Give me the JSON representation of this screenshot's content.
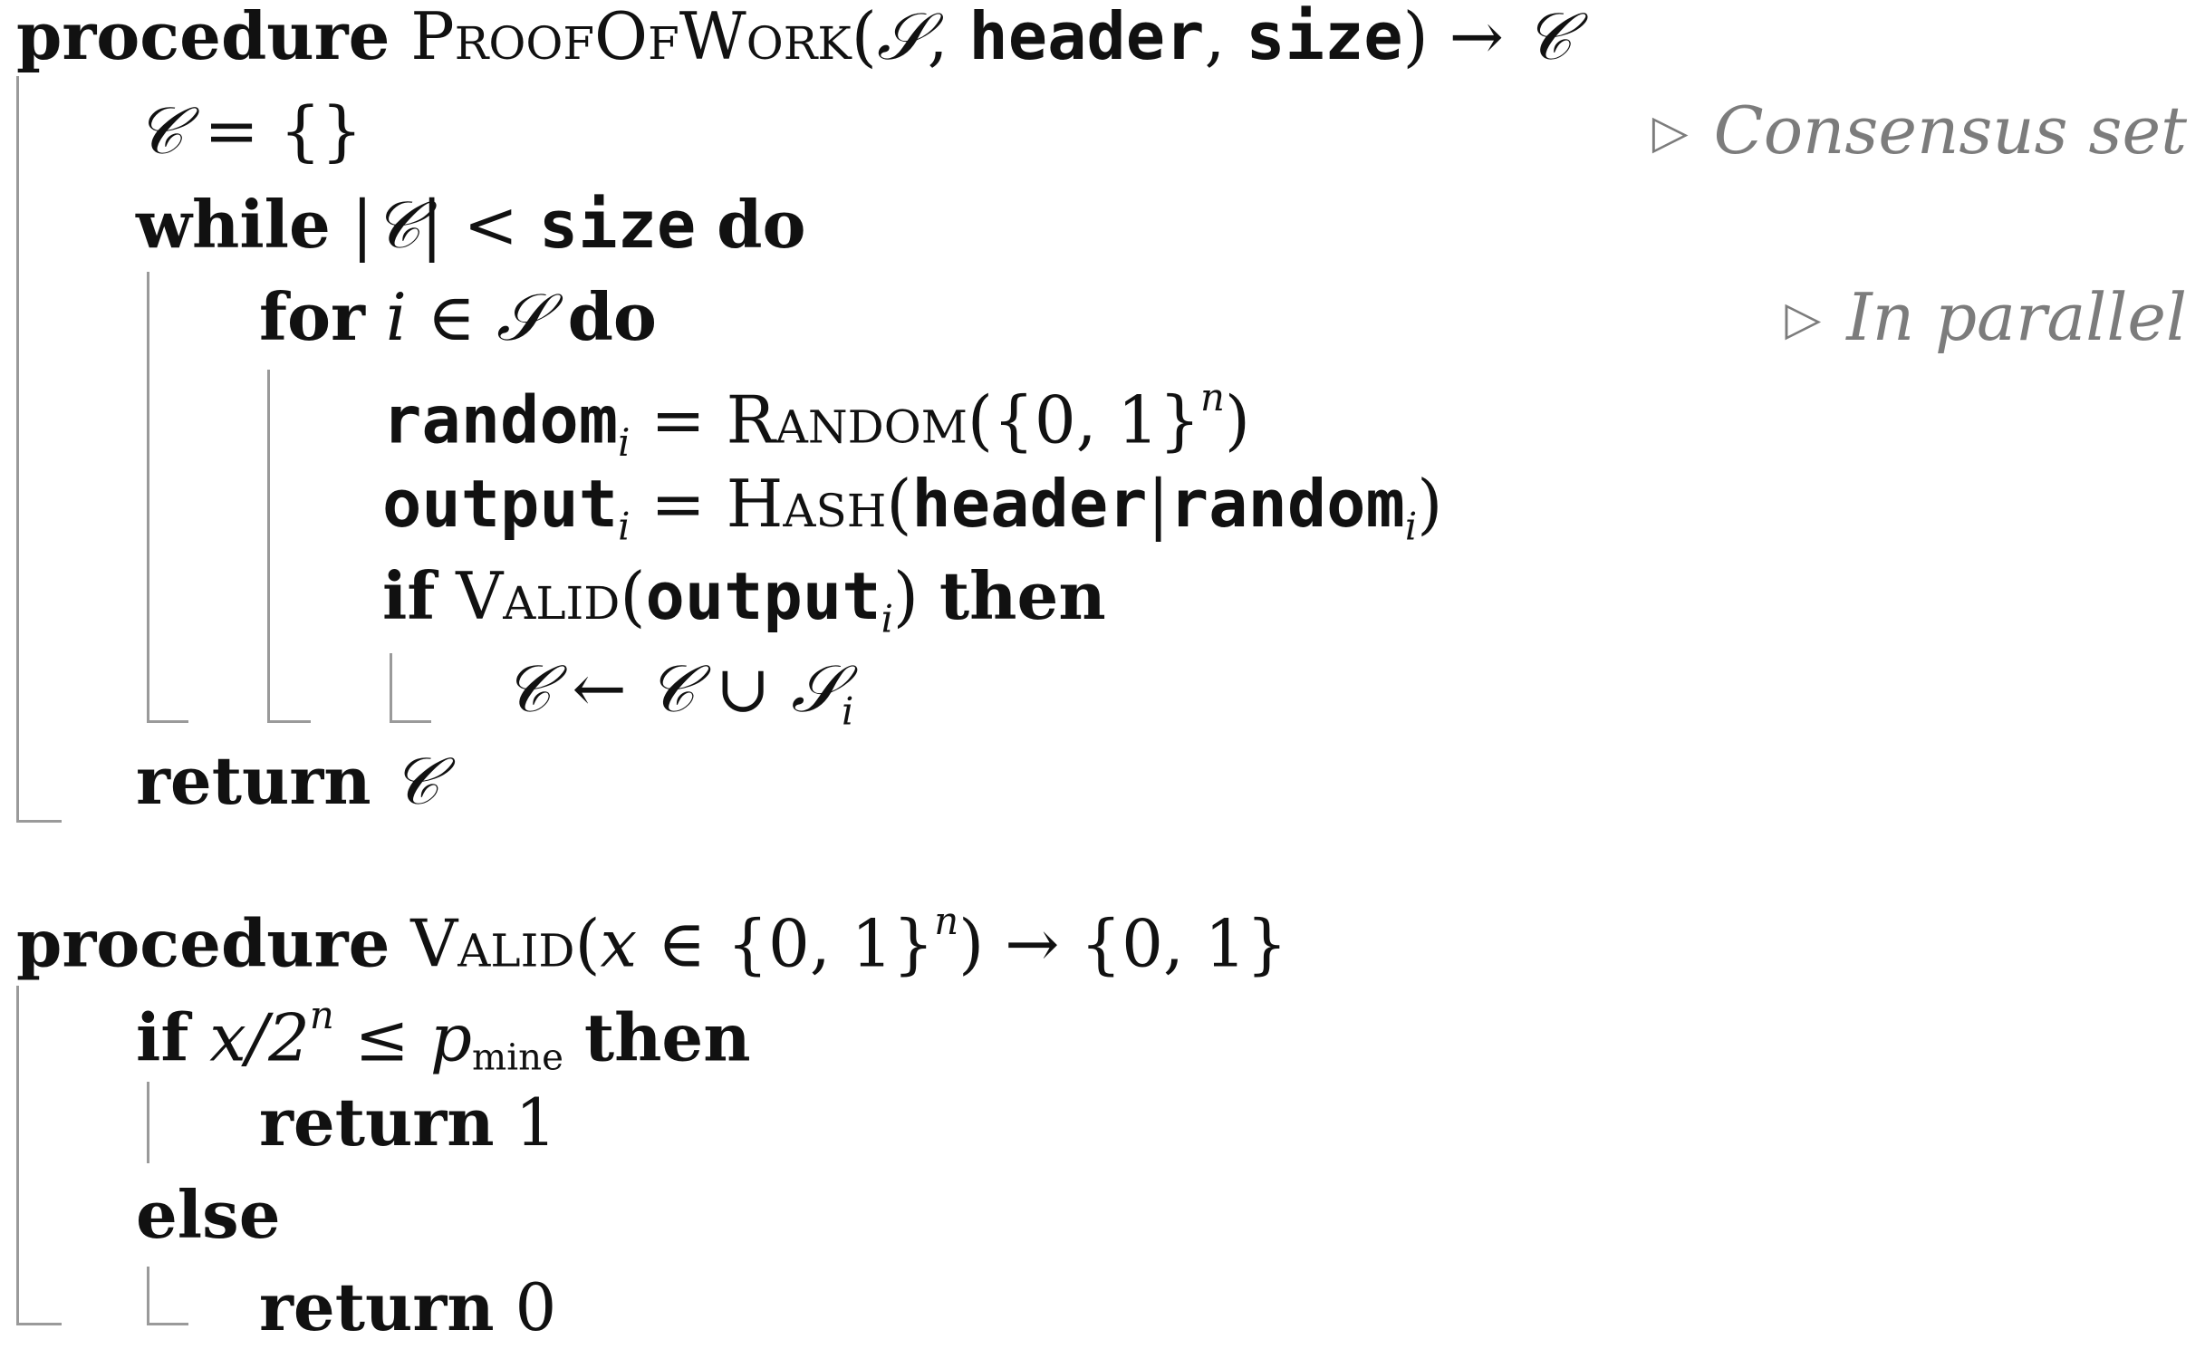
{
  "algorithm_1": {
    "header": {
      "keyword": "procedure",
      "name": "ProofOfWork",
      "args": [
        {
          "text": "𝒮",
          "style": "cal"
        },
        {
          "text": ",",
          "style": "plain"
        },
        {
          "text": "header",
          "style": "mono"
        },
        {
          "text": ",",
          "style": "plain"
        },
        {
          "text": "size",
          "style": "mono"
        }
      ],
      "arrow": "→",
      "return_symbol": "𝒞"
    },
    "init": {
      "symbol": "𝒞",
      "eq": "=",
      "value": "{}",
      "comment": "Consensus set"
    },
    "while": {
      "keyword": "while",
      "abs_open": "|",
      "symbol": "𝒞",
      "abs_close": "|",
      "lt": "<",
      "rhs": "size",
      "do": "do"
    },
    "for": {
      "keyword": "for",
      "var": "i",
      "in": "∈",
      "set": "𝒮",
      "do": "do",
      "comment": "In parallel"
    },
    "random_line": {
      "lhs": "random",
      "lhs_sub": "i",
      "eq": "=",
      "fn": "Random",
      "arg_open": "({0, 1}",
      "arg_sup": "n",
      "arg_close": ")"
    },
    "output_line": {
      "lhs": "output",
      "lhs_sub": "i",
      "eq": "=",
      "fn": "Hash",
      "arg_open": "(",
      "arg1": "header",
      "sep": "|",
      "arg2": "random",
      "arg2_sub": "i",
      "arg_close": ")"
    },
    "if_line": {
      "keyword": "if",
      "fn": "Valid",
      "arg_open": "(",
      "arg": "output",
      "arg_sub": "i",
      "arg_close": ")",
      "then": "then"
    },
    "union_line": {
      "lhs": "𝒞",
      "arrow": "←",
      "rhs1": "𝒞",
      "union": "∪",
      "rhs2": "𝒮",
      "rhs2_sub": "i"
    },
    "return_line": {
      "keyword": "return",
      "value": "𝒞"
    }
  },
  "algorithm_2": {
    "header": {
      "keyword": "procedure",
      "name": "Valid",
      "arg_open": "(",
      "var": "x",
      "in": "∈",
      "set": "{0, 1}",
      "sup": "n",
      "arg_close": ")",
      "arrow": "→",
      "return_set": "{0, 1}"
    },
    "if_line": {
      "keyword": "if",
      "lhs": "x/2",
      "sup": "n",
      "leq": "≤",
      "rhs": "p",
      "rhs_sub": "mine",
      "then": "then"
    },
    "return_1": {
      "keyword": "return",
      "value": "1"
    },
    "else_line": {
      "keyword": "else"
    },
    "return_0": {
      "keyword": "return",
      "value": "0"
    }
  }
}
